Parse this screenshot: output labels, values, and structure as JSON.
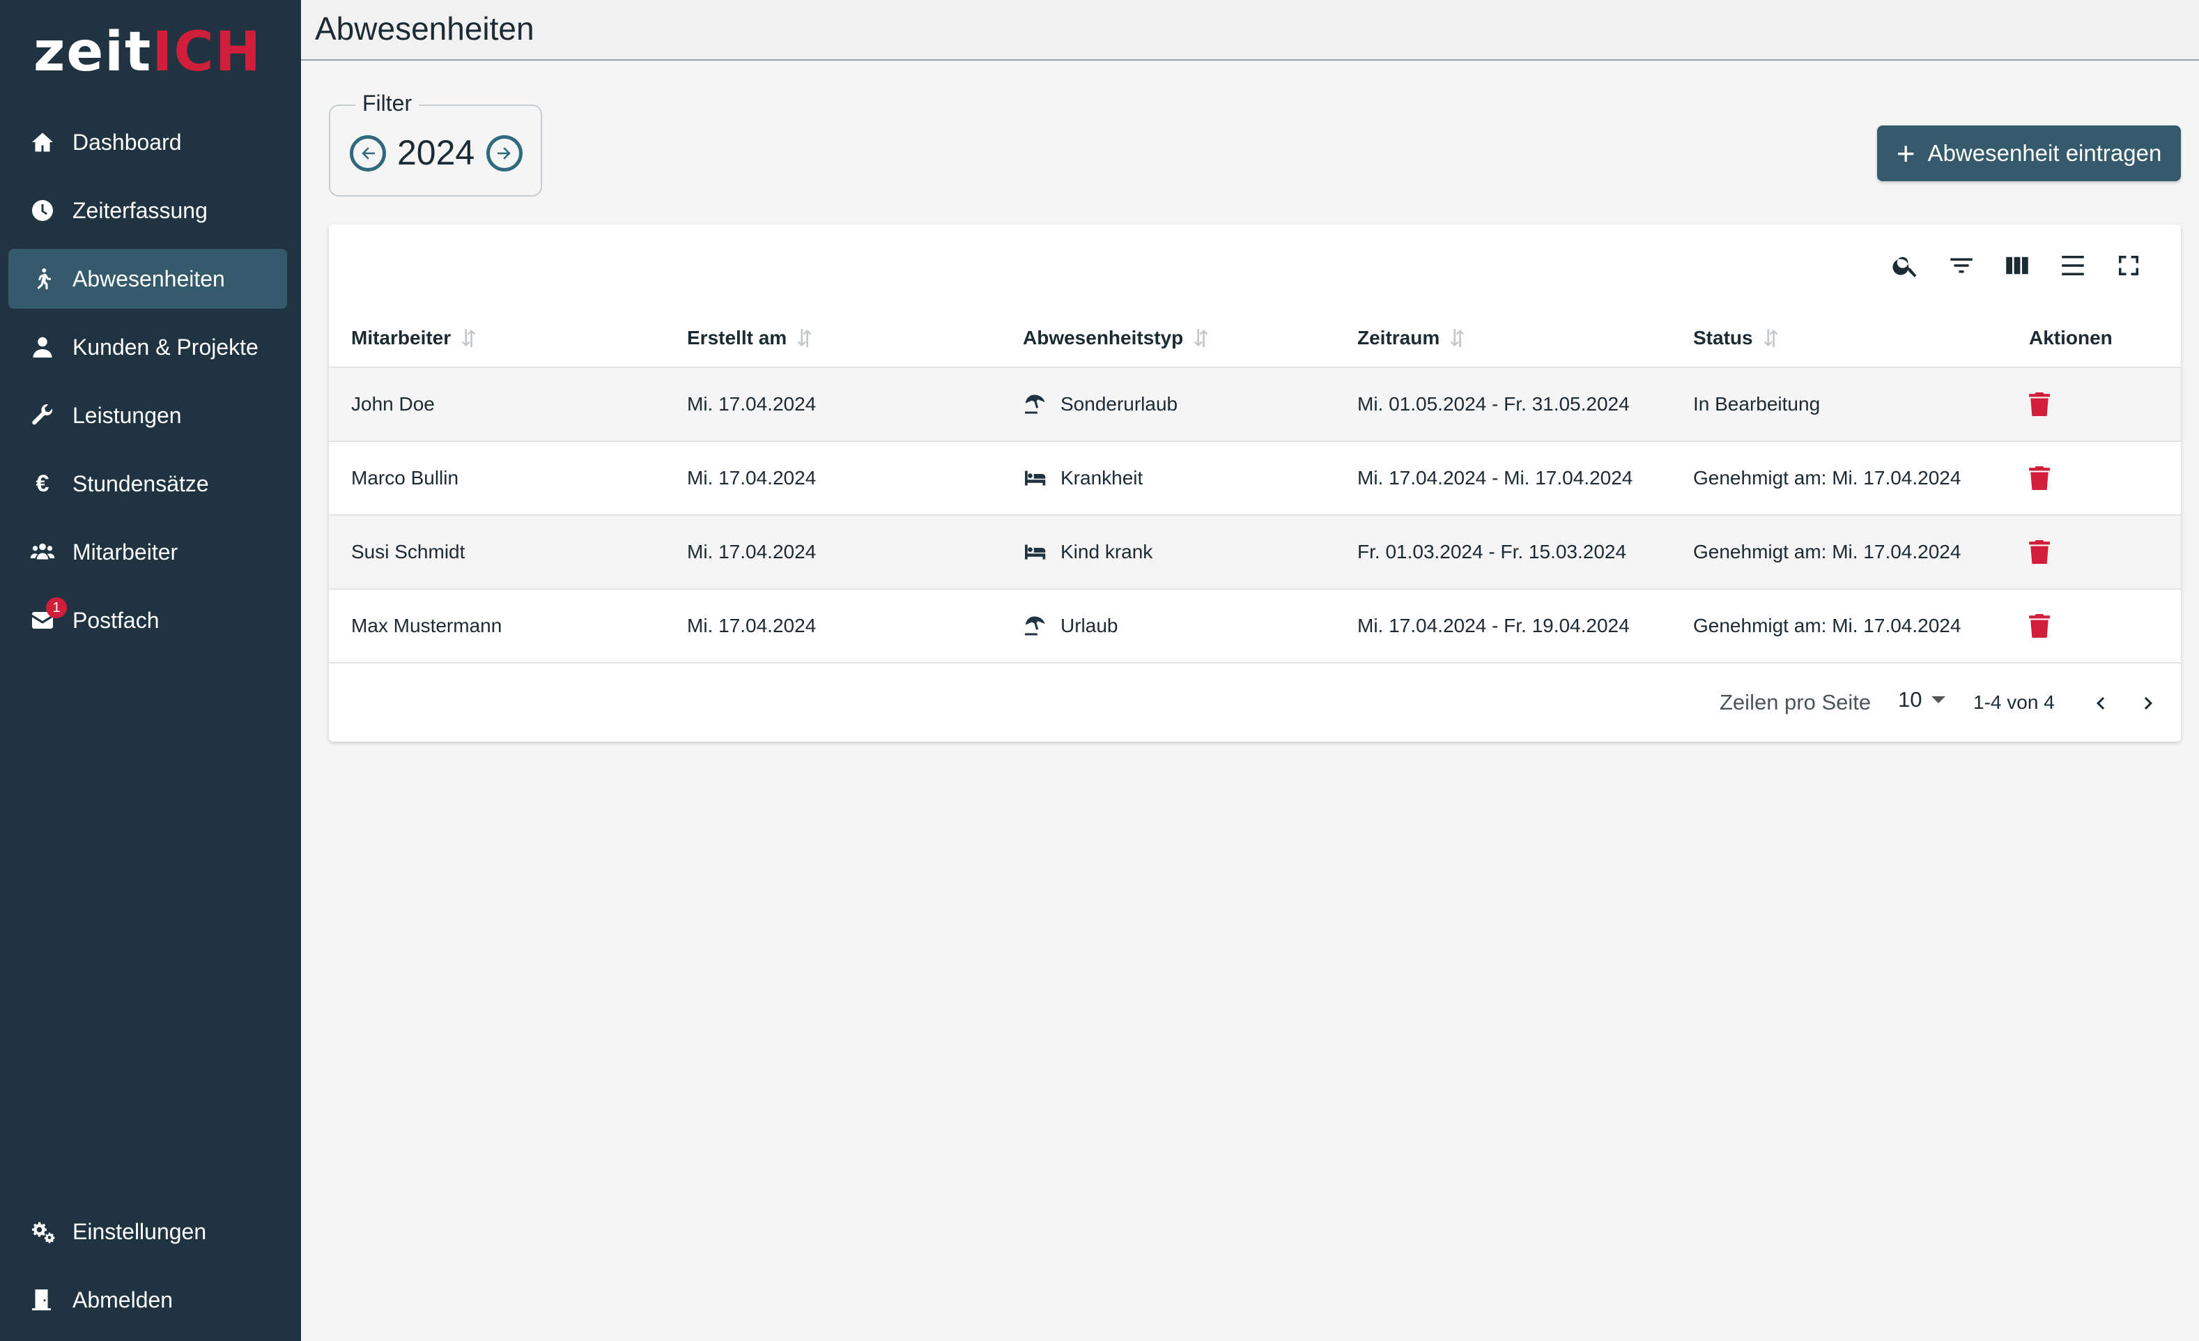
{
  "logo": {
    "part1": "zeit",
    "part2": "ICH"
  },
  "sidebar": {
    "items": [
      {
        "label": "Dashboard",
        "icon": "home-icon"
      },
      {
        "label": "Zeiterfassung",
        "icon": "clock-icon"
      },
      {
        "label": "Abwesenheiten",
        "icon": "walking-icon",
        "active": true
      },
      {
        "label": "Kunden & Projekte",
        "icon": "user-icon"
      },
      {
        "label": "Leistungen",
        "icon": "wrench-icon"
      },
      {
        "label": "Stundensätze",
        "icon": "euro-icon",
        "glyph": "€"
      },
      {
        "label": "Mitarbeiter",
        "icon": "users-icon"
      },
      {
        "label": "Postfach",
        "icon": "envelope-icon",
        "badge": "1"
      }
    ],
    "bottom": [
      {
        "label": "Einstellungen",
        "icon": "gears-icon"
      },
      {
        "label": "Abmelden",
        "icon": "door-icon"
      }
    ]
  },
  "header": {
    "title": "Abwesenheiten"
  },
  "filter": {
    "legend": "Filter",
    "year": "2024"
  },
  "actions": {
    "add_plus": "+",
    "add_label": "Abwesenheit eintragen"
  },
  "table": {
    "columns": [
      "Mitarbeiter",
      "Erstellt am",
      "Abwesenheitstyp",
      "Zeitraum",
      "Status",
      "Aktionen"
    ],
    "rows": [
      {
        "employee": "John Doe",
        "created": "Mi. 17.04.2024",
        "type": "Sonderurlaub",
        "type_icon": "beach-umbrella-icon",
        "period": "Mi. 01.05.2024 - Fr. 31.05.2024",
        "status": "In Bearbeitung"
      },
      {
        "employee": "Marco Bullin",
        "created": "Mi. 17.04.2024",
        "type": "Krankheit",
        "type_icon": "bed-icon",
        "period": "Mi. 17.04.2024 - Mi. 17.04.2024",
        "status": "Genehmigt am: Mi. 17.04.2024"
      },
      {
        "employee": "Susi Schmidt",
        "created": "Mi. 17.04.2024",
        "type": "Kind krank",
        "type_icon": "bed-icon",
        "period": "Fr. 01.03.2024 - Fr. 15.03.2024",
        "status": "Genehmigt am: Mi. 17.04.2024"
      },
      {
        "employee": "Max Mustermann",
        "created": "Mi. 17.04.2024",
        "type": "Urlaub",
        "type_icon": "beach-umbrella-icon",
        "period": "Mi. 17.04.2024 - Fr. 19.04.2024",
        "status": "Genehmigt am: Mi. 17.04.2024"
      }
    ]
  },
  "pagination": {
    "rows_per_page_label": "Zeilen pro Seite",
    "rows_per_page": "10",
    "range": "1-4 von 4"
  },
  "colors": {
    "sidebar_bg": "#1f3341",
    "accent": "#355a6c",
    "brand_red": "#d11f3b"
  }
}
